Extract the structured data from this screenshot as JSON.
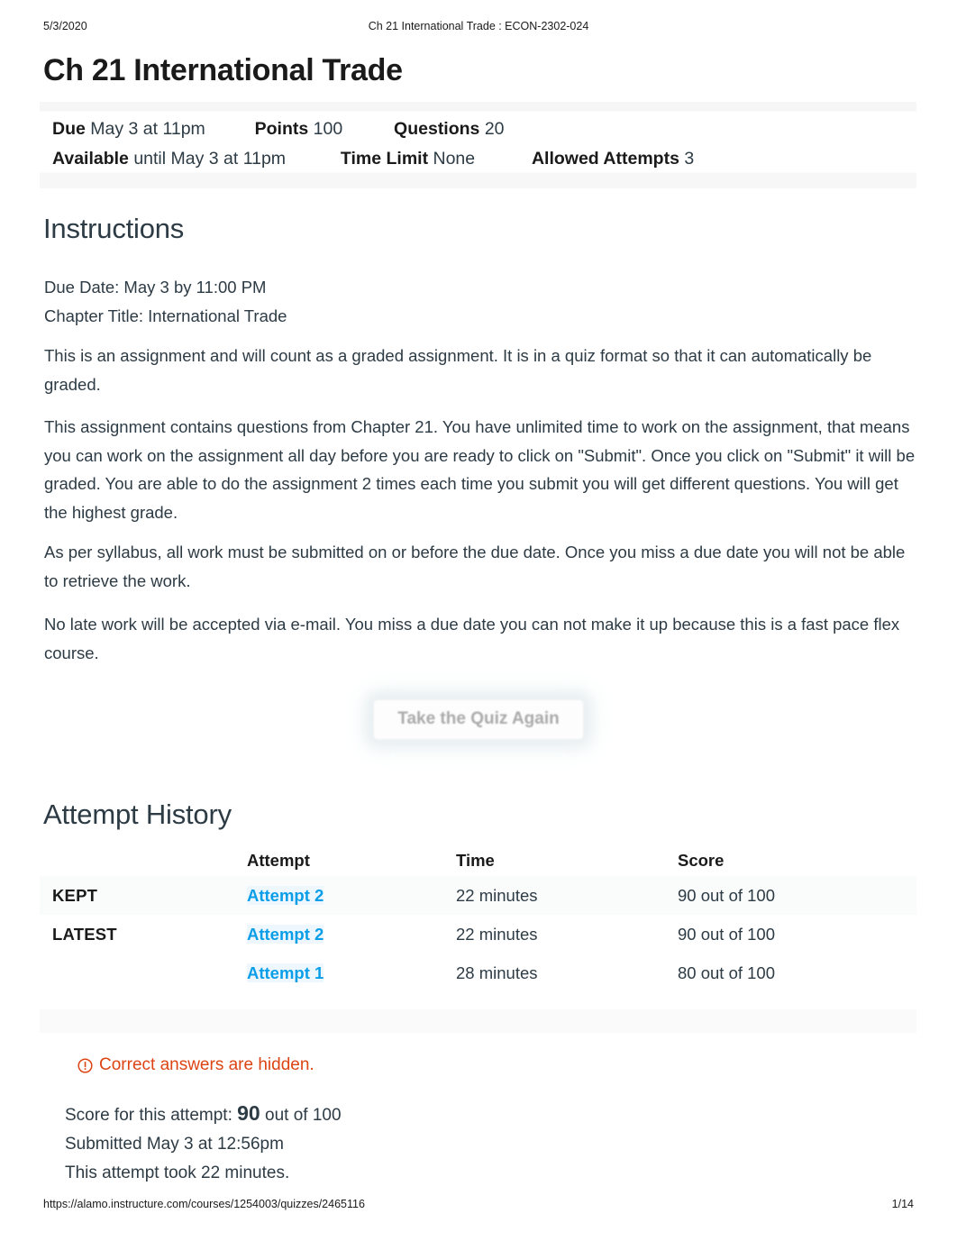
{
  "print_header": {
    "date": "5/3/2020",
    "title": "Ch 21 International Trade : ECON-2302-024"
  },
  "quiz": {
    "title": "Ch 21 International Trade",
    "details": {
      "due_label": "Due",
      "due_value": "May 3 at 11pm",
      "points_label": "Points",
      "points_value": "100",
      "questions_label": "Questions",
      "questions_value": "20",
      "available_label": "Available",
      "available_value": "until May 3 at 11pm",
      "time_limit_label": "Time Limit",
      "time_limit_value": "None",
      "allowed_attempts_label": "Allowed Attempts",
      "allowed_attempts_value": "3"
    }
  },
  "instructions": {
    "heading": "Instructions",
    "due_date_line": "Due Date: May 3 by 11:00 PM",
    "chapter_line": "Chapter Title: International Trade",
    "paragraphs": [
      "This is an assignment and will count as a graded assignment.  It is in a quiz format so that it can automatically be graded.",
      "This assignment contains questions from Chapter 21.  You have unlimited time to work on the assignment, that means you can work on the assignment all day before you are ready to click on \"Submit\".   Once you click on \"Submit\" it will be graded.  You are able to do the assignment 2 times each time you submit you will get different questions. You will get the highest grade.",
      "As per syllabus, all work must be submitted on or before the due date.  Once you miss a due date you will not be able to retrieve the work.",
      "No late work will be accepted via e-mail.  You miss a due date you can not make it up because this is a fast pace flex course."
    ]
  },
  "retake_button": {
    "label": "Take the Quiz Again"
  },
  "attempt_history": {
    "heading": "Attempt History",
    "columns": [
      "",
      "Attempt",
      "Time",
      "Score"
    ],
    "rows": [
      {
        "label": "KEPT",
        "attempt": "Attempt 2",
        "time": "22 minutes",
        "score": "90 out of 100"
      },
      {
        "label": "LATEST",
        "attempt": "Attempt 2",
        "time": "22 minutes",
        "score": "90 out of 100"
      },
      {
        "label": "",
        "attempt": "Attempt 1",
        "time": "28 minutes",
        "score": "80 out of 100"
      }
    ]
  },
  "hidden_notice": {
    "icon": "warning-circle-icon",
    "text": "Correct answers are hidden.",
    "color": "#dd4413"
  },
  "score_summary": {
    "score_prefix": "Score for this attempt:",
    "score_value": "90",
    "score_suffix": "out of 100",
    "submitted": "Submitted May 3 at 12:56pm",
    "duration": "This attempt took 22 minutes."
  },
  "print_footer": {
    "url": "https://alamo.instructure.com/courses/1254003/quizzes/2465116",
    "page": "1/14"
  },
  "colors": {
    "link_blue": "#0b9ee8",
    "warning_orange": "#dd4413",
    "text": "#2d3b45"
  }
}
